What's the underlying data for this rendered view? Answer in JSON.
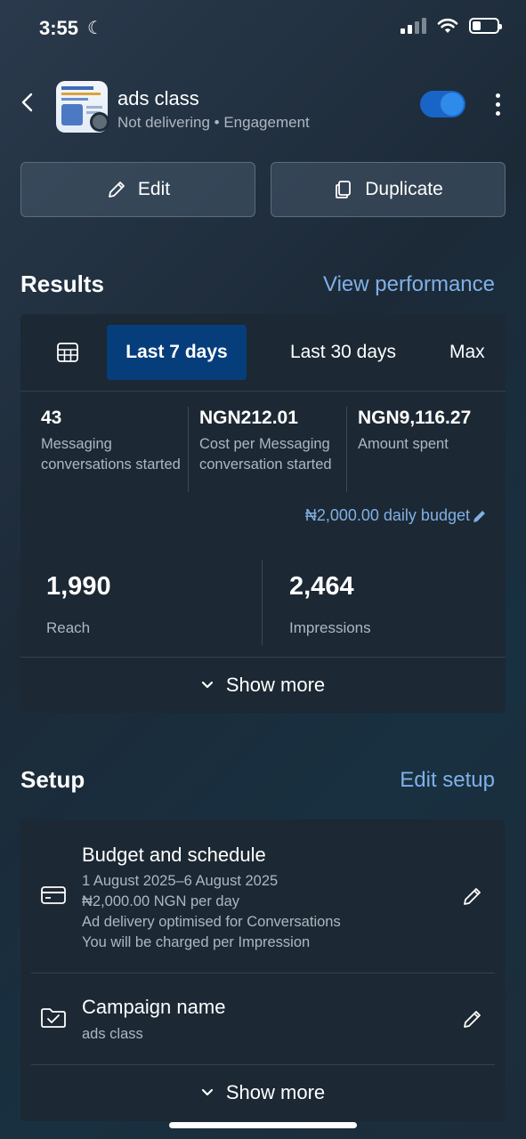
{
  "status_bar": {
    "time": "3:55"
  },
  "header": {
    "title": "ads class",
    "subtitle": "Not delivering • Engagement"
  },
  "actions": {
    "edit_label": "Edit",
    "duplicate_label": "Duplicate"
  },
  "results": {
    "title": "Results",
    "link": "View performance",
    "tabs": [
      {
        "label": "Last 7 days",
        "active": true
      },
      {
        "label": "Last 30 days",
        "active": false
      },
      {
        "label": "Max",
        "active": false
      }
    ],
    "metrics": [
      {
        "value": "43",
        "label": "Messaging conversations started"
      },
      {
        "value": "NGN212.01",
        "label": "Cost per Messaging conversation started"
      },
      {
        "value": "NGN9,116.27",
        "label": "Amount spent"
      }
    ],
    "budget": "₦2,000.00 daily budget",
    "big_metrics": [
      {
        "value": "1,990",
        "label": "Reach"
      },
      {
        "value": "2,464",
        "label": "Impressions"
      }
    ],
    "show_more": "Show more"
  },
  "setup": {
    "title": "Setup",
    "link": "Edit setup",
    "budget_schedule": {
      "title": "Budget and schedule",
      "lines": [
        "1 August 2025–6 August 2025",
        "₦2,000.00 NGN per day",
        "Ad delivery optimised for Conversations",
        "You will be charged per Impression"
      ]
    },
    "campaign_name": {
      "title": "Campaign name",
      "value": "ads class"
    },
    "show_more": "Show more"
  },
  "colors": {
    "accent": "#7fb0e6",
    "toggle_on": "#1865c7",
    "active_tab": "#063e7c",
    "card": "#1c2833"
  }
}
